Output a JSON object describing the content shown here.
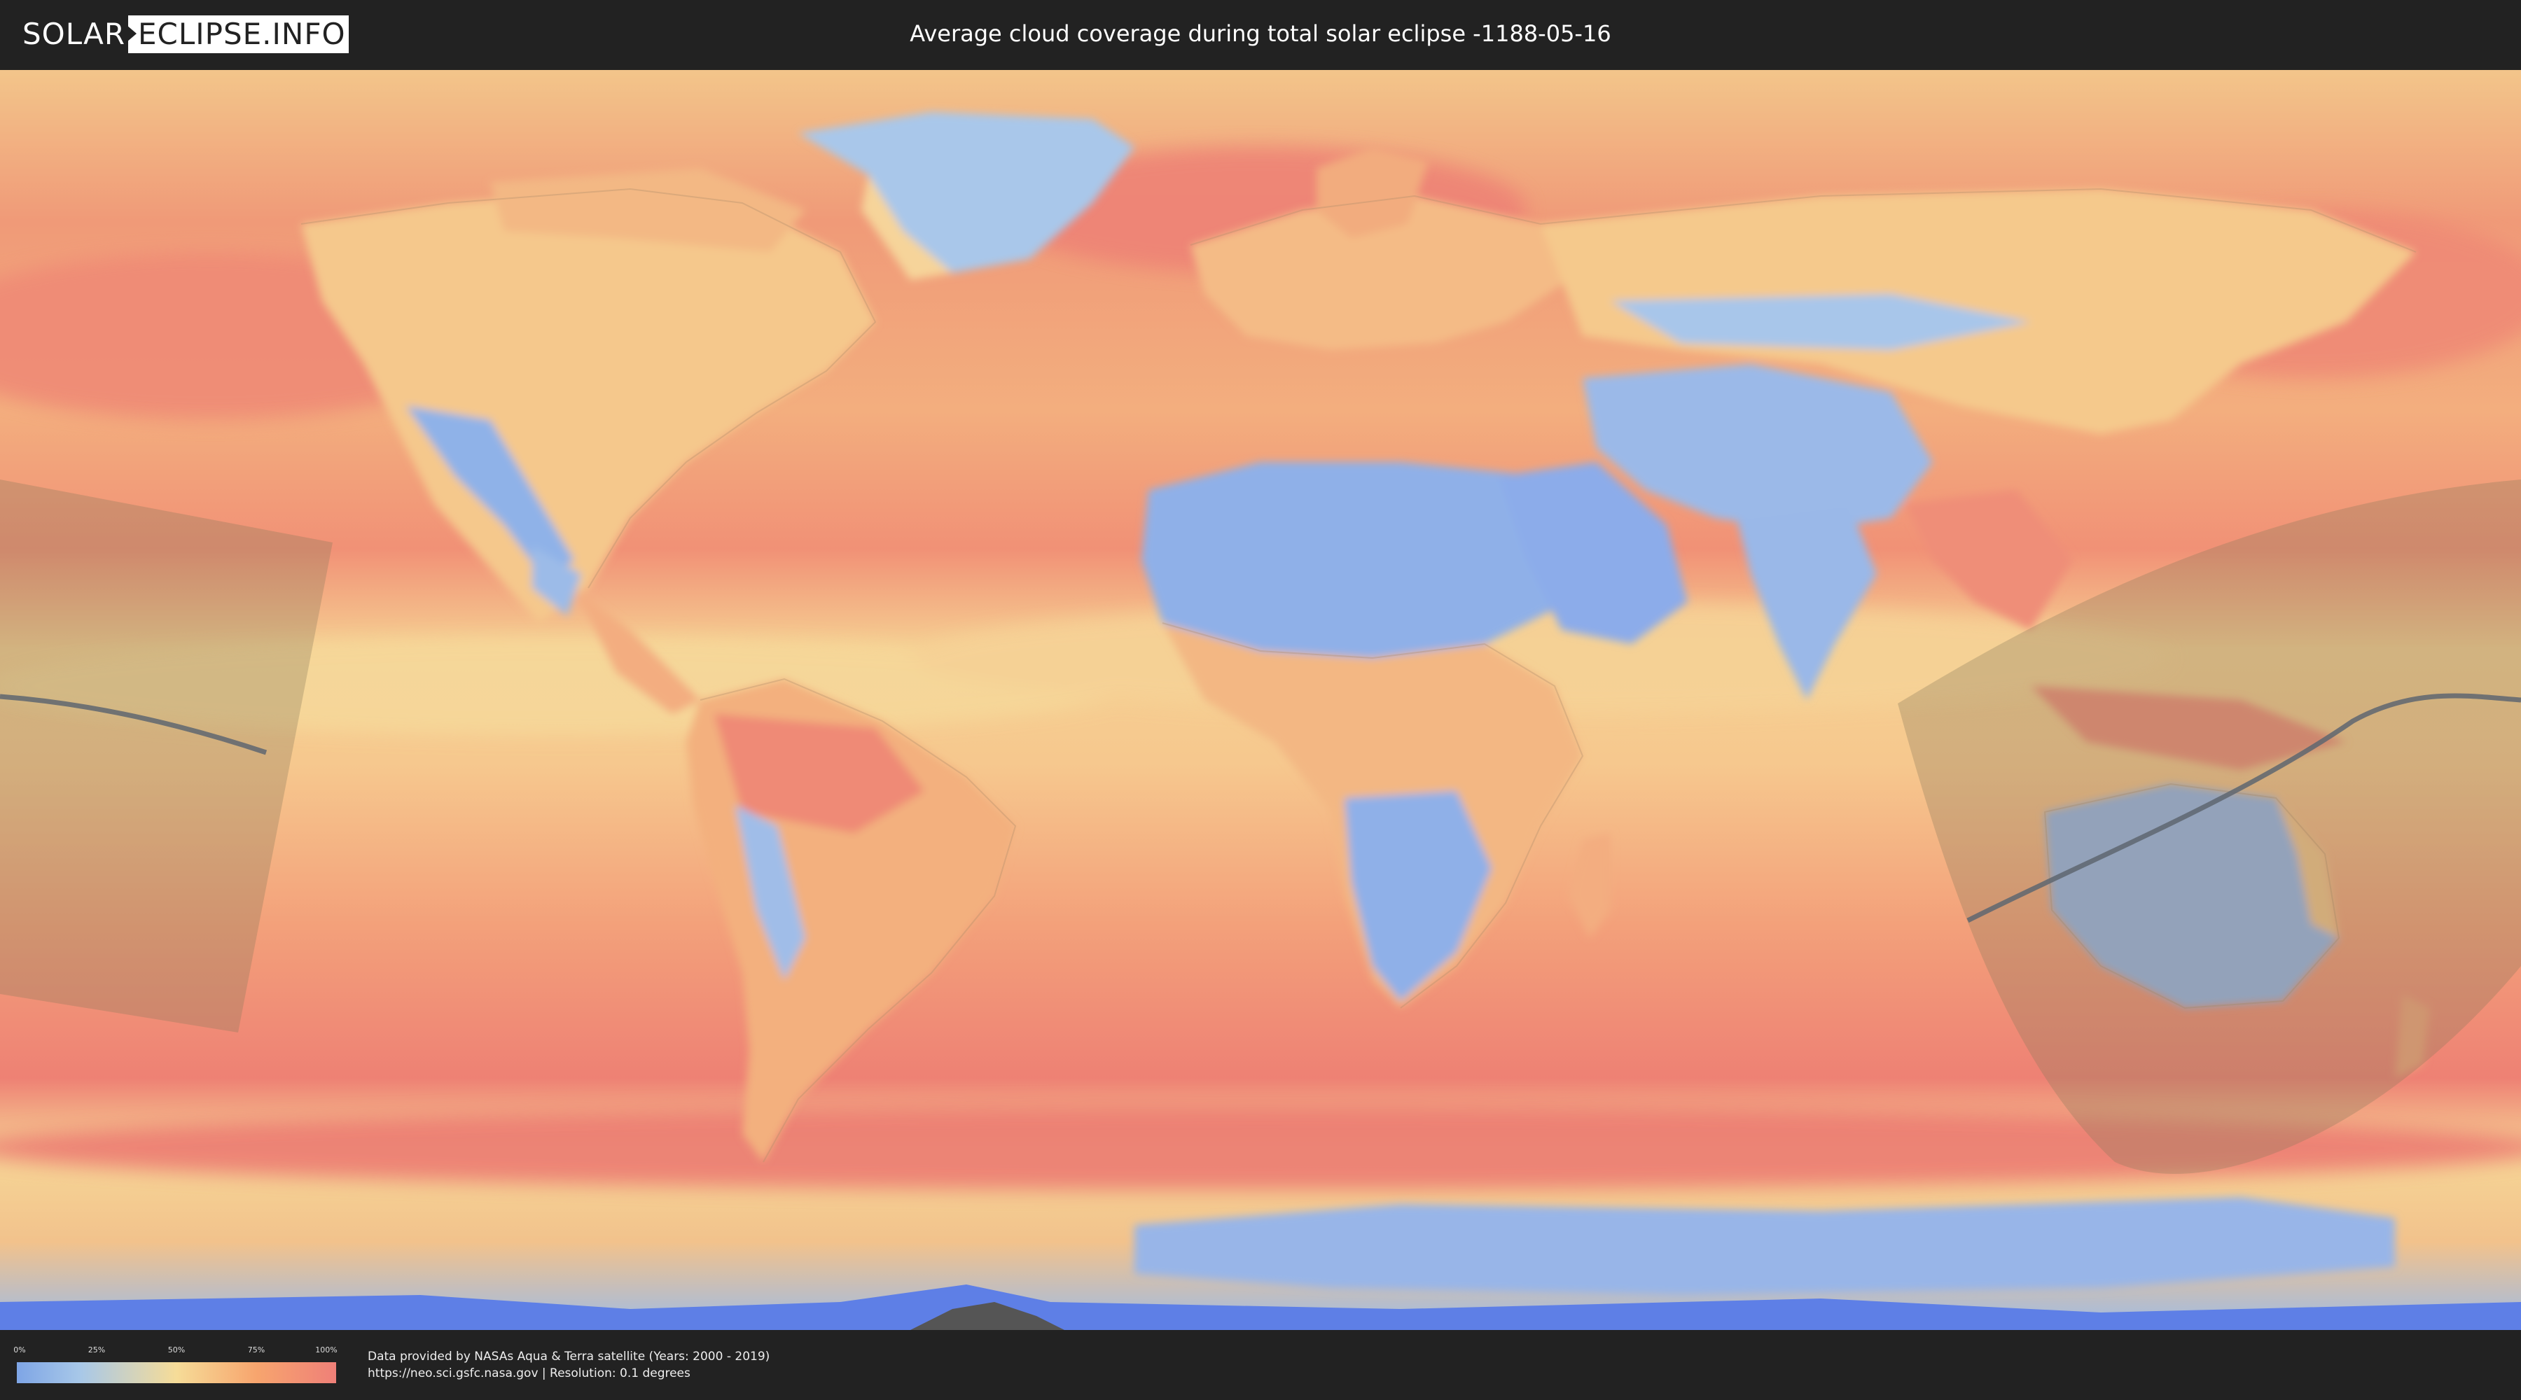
{
  "header": {
    "logo_left": "SOLAR",
    "logo_right": "ECLIPSE.INFO",
    "title": "Average cloud coverage during total solar eclipse -1188-05-16"
  },
  "legend": {
    "ticks": [
      "0%",
      "25%",
      "50%",
      "75%",
      "100%"
    ],
    "colors": [
      "#7ea5e6",
      "#a8c8e8",
      "#f6dc98",
      "#f7a56e",
      "#ef8078"
    ]
  },
  "footer": {
    "line1": "Data provided by NASAs Aqua & Terra satellite (Years: 2000 - 2019)",
    "line2": "https://neo.sci.gsfc.nasa.gov | Resolution: 0.1 degrees"
  },
  "map": {
    "projection": "equirectangular",
    "layer": "cloud-coverage",
    "overlay": "eclipse-totality-path"
  }
}
